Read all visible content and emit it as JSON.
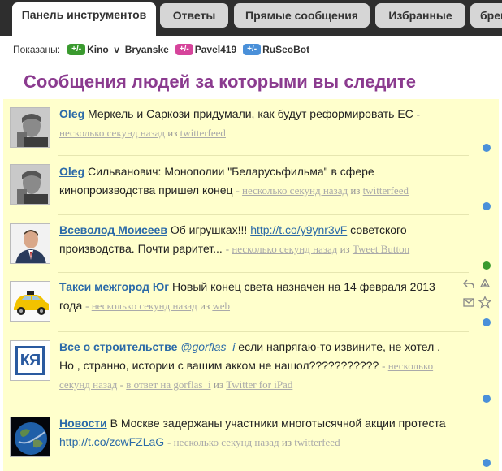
{
  "tabs": [
    {
      "label": "Панель инструментов",
      "active": true
    },
    {
      "label": "Ответы"
    },
    {
      "label": "Прямые сообщения"
    },
    {
      "label": "Избранные"
    },
    {
      "label": "бренд"
    }
  ],
  "filters": {
    "label": "Показаны:",
    "toggle": "+/-",
    "chips": [
      {
        "name": "Kino_v_Bryanske",
        "color": "#3a9a2f"
      },
      {
        "name": "Pavel419",
        "color": "#d6449b"
      },
      {
        "name": "RuSeoBot",
        "color": "#4a90d9"
      }
    ]
  },
  "heading": "Сообщения людей за которыми вы следите",
  "colors": {
    "heading": "#8b3b8f",
    "feed_bg": "#ffffcc",
    "link": "#2b6aa8"
  },
  "separators": {
    "dash": "-",
    "from": "из"
  },
  "items": [
    {
      "author": "Oleg",
      "text": "Меркель и Саркози придумали, как будут реформировать ЕС",
      "time": "несколько секунд назад",
      "source": "twitterfeed",
      "avatar_icon": "person-hand-on-face-avatar",
      "dot": "blue"
    },
    {
      "author": "Oleg",
      "text": "Сильванович: Монополии \"Беларусьфильма\" в сфере кинопроизводства пришел конец",
      "time": "несколько секунд назад",
      "source": "twitterfeed",
      "avatar_icon": "person-hand-on-face-avatar",
      "dot": "blue"
    },
    {
      "author": "Всеволод Моисеев",
      "text": "Об игрушках!!!",
      "link": "http://t.co/y9ynr3vF",
      "text2": "советского производства. Почти раритет...",
      "time": "несколько секунд назад",
      "source": "Tweet Button",
      "avatar_icon": "man-in-suit-avatar",
      "dot": "green"
    },
    {
      "author": "Такси межгород Юг",
      "text": "Новый конец света назначен на 14 февраля 2013 года",
      "time": "несколько секунд назад",
      "source": "web",
      "avatar_icon": "yellow-taxi-avatar",
      "dot": "blue",
      "actions": [
        "reply-icon",
        "retweet-icon",
        "direct-message-icon",
        "favorite-star-icon"
      ]
    },
    {
      "author": "Все о строительстве",
      "mention": "@gorflas_i",
      "text": "если напрягаю-то извините, не хотел . Но , странно, истории с вашим акком не нашол???????????",
      "time": "несколько секунд назад",
      "reply_to": "в ответ на gorflas_i",
      "source": "Twitter for iPad",
      "avatar_icon": "ky-logo-avatar",
      "avatar_text": "КЯ",
      "dot": "blue"
    },
    {
      "author": "Новости",
      "text": "В Москве задержаны участники многотысячной акции протеста",
      "link": "http://t.co/zcwFZLaG",
      "time": "несколько секунд назад",
      "source": "twitterfeed",
      "avatar_icon": "earth-globe-avatar",
      "dot": "blue"
    }
  ]
}
